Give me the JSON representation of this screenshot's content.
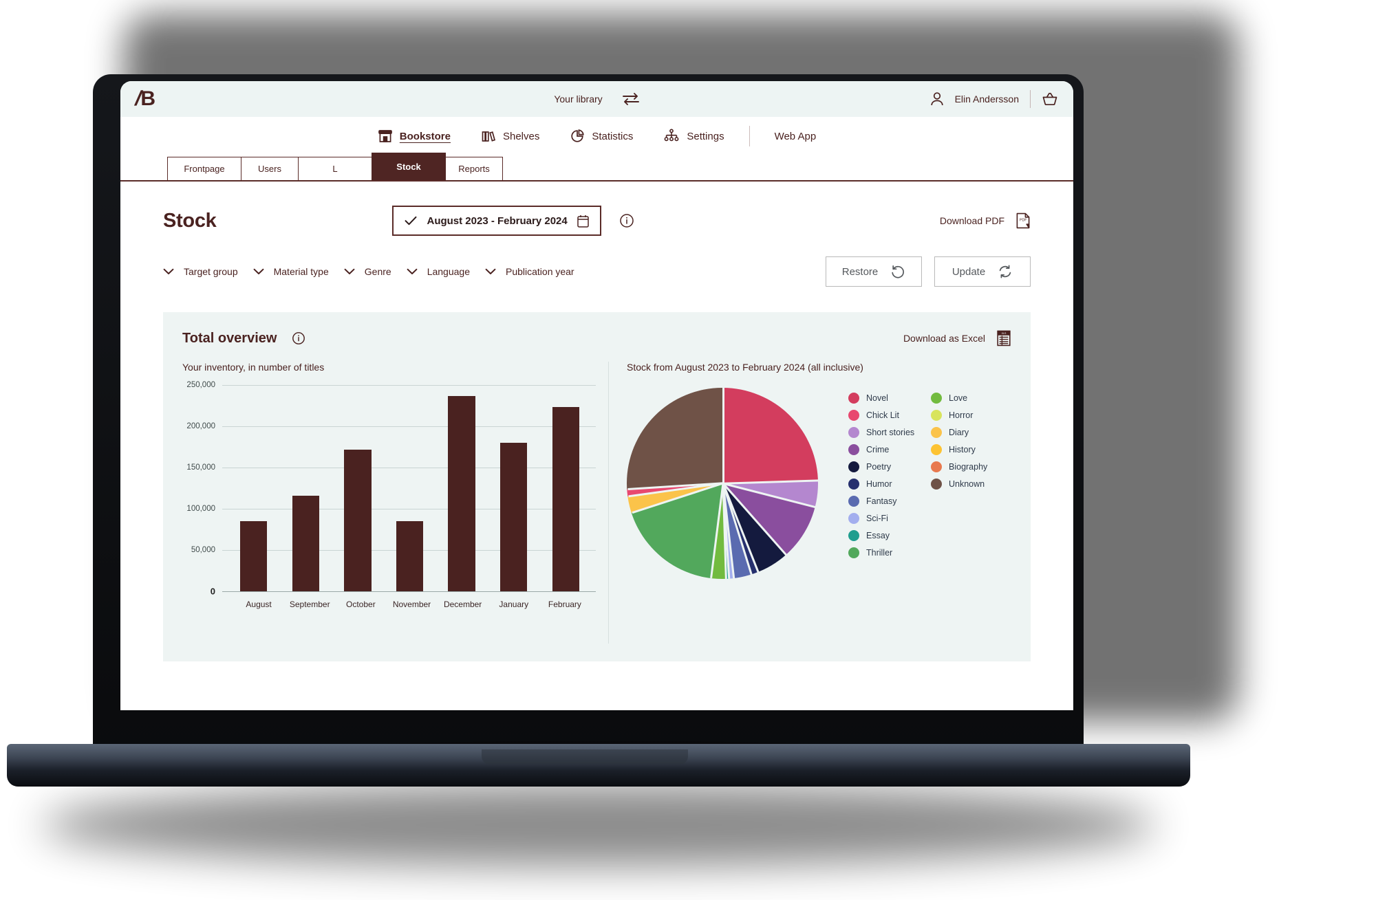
{
  "brand": {
    "logo_text": "B",
    "logo_slash": "/"
  },
  "topbar": {
    "library_label": "Your library",
    "swap_icon": "swap-arrows-icon",
    "user_name": "Elin Andersson",
    "user_icon": "user-icon",
    "basket_icon": "basket-icon"
  },
  "nav": {
    "items": [
      {
        "label": "Bookstore",
        "icon": "store-icon",
        "active": true
      },
      {
        "label": "Shelves",
        "icon": "books-icon",
        "active": false
      },
      {
        "label": "Statistics",
        "icon": "pie-chart-icon",
        "active": false
      },
      {
        "label": "Settings",
        "icon": "sitemap-icon",
        "active": false
      },
      {
        "label": "Web App",
        "icon": "",
        "active": false
      }
    ]
  },
  "tabs": [
    {
      "label": "Frontpage",
      "active": false
    },
    {
      "label": "Users",
      "active": false
    },
    {
      "label": "L",
      "active": false
    },
    {
      "label": "Stock",
      "active": true
    },
    {
      "label": "Reports",
      "active": false
    }
  ],
  "page": {
    "title": "Stock",
    "date_range": "August 2023 - February 2024",
    "date_check_icon": "check-icon",
    "calendar_icon": "calendar-icon",
    "info_icon": "info-circle-icon",
    "download_pdf_label": "Download PDF",
    "pdf_icon": "pdf-file-icon"
  },
  "filters": [
    {
      "label": "Target group",
      "icon": "chevron-down-icon"
    },
    {
      "label": "Material type",
      "icon": "chevron-down-icon"
    },
    {
      "label": "Genre",
      "icon": "chevron-down-icon"
    },
    {
      "label": "Language",
      "icon": "chevron-down-icon"
    },
    {
      "label": "Publication year",
      "icon": "chevron-down-icon"
    }
  ],
  "actions": {
    "restore_label": "Restore",
    "restore_icon": "undo-icon",
    "update_label": "Update",
    "update_icon": "refresh-icon"
  },
  "card": {
    "title": "Total overview",
    "info_icon": "info-circle-icon",
    "download_excel_label": "Download as Excel",
    "excel_icon": "excel-file-icon"
  },
  "colors": {
    "brand_dark": "#4a2220",
    "bar_fill": "#4a2220",
    "card_bg": "#eef4f3",
    "topbar_bg": "#edf4f3"
  },
  "chart_data": [
    {
      "type": "bar",
      "title": "Your inventory, in number of titles",
      "xlabel": "",
      "ylabel": "",
      "ylim": [
        0,
        250000
      ],
      "yticks": [
        0,
        50000,
        100000,
        150000,
        200000,
        250000
      ],
      "ytick_labels": [
        "0",
        "50,000",
        "100,000",
        "150,000",
        "200,000",
        "250,000"
      ],
      "grid": true,
      "categories": [
        "August",
        "September",
        "October",
        "November",
        "December",
        "January",
        "February"
      ],
      "values": [
        85000,
        116000,
        172000,
        85000,
        237000,
        180000,
        223000
      ],
      "series_color": "#4a2220"
    },
    {
      "type": "pie",
      "title": "Stock from August 2023 to February 2024 (all inclusive)",
      "legend_position": "right",
      "labels": [
        "Novel",
        "Chick Lit",
        "Short stories",
        "Crime",
        "Poetry",
        "Humor",
        "Fantasy",
        "Sci-Fi",
        "Essay",
        "Thriller",
        "Love",
        "Horror",
        "Diary",
        "History",
        "Biography",
        "Unknown"
      ],
      "colors": [
        "#d33d5e",
        "#e8486f",
        "#b487cf",
        "#8a4e9e",
        "#141a3e",
        "#26306e",
        "#5a6bb0",
        "#a3aeee",
        "#1f9e8f",
        "#52a85c",
        "#72bb3f",
        "#d3e champion",
        "#fbc34a",
        "#fdc332",
        "#e8794e",
        "#6f5247"
      ],
      "slice_colors": {
        "Novel": "#d33d5e",
        "Chick Lit": "#e8486f",
        "Short stories": "#b487cf",
        "Crime": "#8a4e9e",
        "Poetry": "#141a3e",
        "Humor": "#26306e",
        "Fantasy": "#5a6bb0",
        "Sci-Fi": "#a3aeee",
        "Essay": "#1f9e8f",
        "Thriller": "#52a85c",
        "Love": "#72bb3f",
        "Horror": "#d8e45c",
        "Diary": "#fbc34a",
        "History": "#fdc332",
        "Biography": "#e8794e",
        "Unknown": "#6f5247"
      },
      "order_clockwise_from_top": [
        "Novel",
        "Short stories",
        "Crime",
        "Poetry",
        "Humor",
        "Fantasy",
        "Sci-Fi",
        "Essay",
        "Love",
        "Thriller",
        "Diary",
        "Chick Lit",
        "Unknown"
      ],
      "values_percent": [
        24.5,
        4.5,
        9.5,
        5.5,
        1.2,
        3.0,
        0.8,
        0.5,
        2.5,
        18.0,
        2.8,
        1.2,
        26.0
      ],
      "legend_column_1": [
        "Novel",
        "Chick Lit",
        "Short stories",
        "Crime",
        "Poetry",
        "Humor",
        "Fantasy",
        "Sci-Fi",
        "Essay",
        "Thriller",
        "Love",
        "Horror",
        "Diary"
      ],
      "legend_column_2": [
        "History",
        "Biography",
        "Unknown"
      ]
    }
  ]
}
